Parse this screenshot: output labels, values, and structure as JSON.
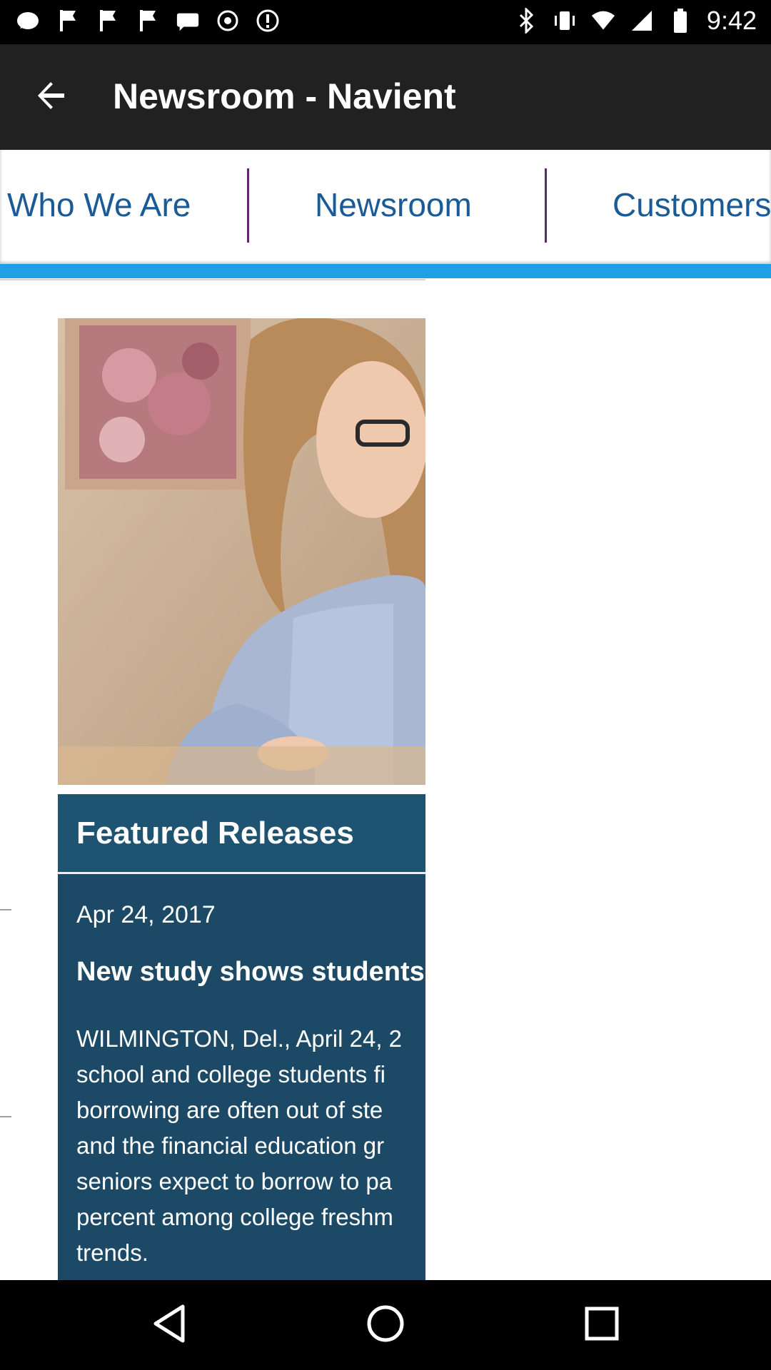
{
  "status_bar": {
    "time": "9:42",
    "left_icons": [
      "whatsapp-icon",
      "flag-icon",
      "flag-icon",
      "flag-icon",
      "sms-icon",
      "notification-icon",
      "alert-icon"
    ],
    "right_icons": [
      "bluetooth-icon",
      "vibrate-icon",
      "wifi-icon",
      "signal-icon",
      "battery-icon"
    ]
  },
  "app_bar": {
    "title": "Newsroom - Navient",
    "back_icon": "arrow-back-icon"
  },
  "site_nav": {
    "tabs": [
      {
        "label": "Who We Are"
      },
      {
        "label": "Newsroom"
      },
      {
        "label": "Customers"
      }
    ],
    "accent_color": "#1ea0e6",
    "tab_text_color": "#1a5a96"
  },
  "hero_image": {
    "alt": "woman at desk"
  },
  "featured": {
    "heading": "Featured Releases",
    "date": "Apr 24, 2017",
    "headline": "New study shows students",
    "body_lines": [
      "WILMINGTON, Del., April 24, 2",
      "school and college students fi",
      "borrowing are often out of ste",
      "and the financial education gr",
      "seniors expect to borrow to pa",
      "percent among college freshm",
      "trends."
    ],
    "card_color": "#1c4a66"
  },
  "nav_bar": {
    "back_icon": "nav-back-icon",
    "home_icon": "nav-home-icon",
    "recents_icon": "nav-recents-icon"
  }
}
